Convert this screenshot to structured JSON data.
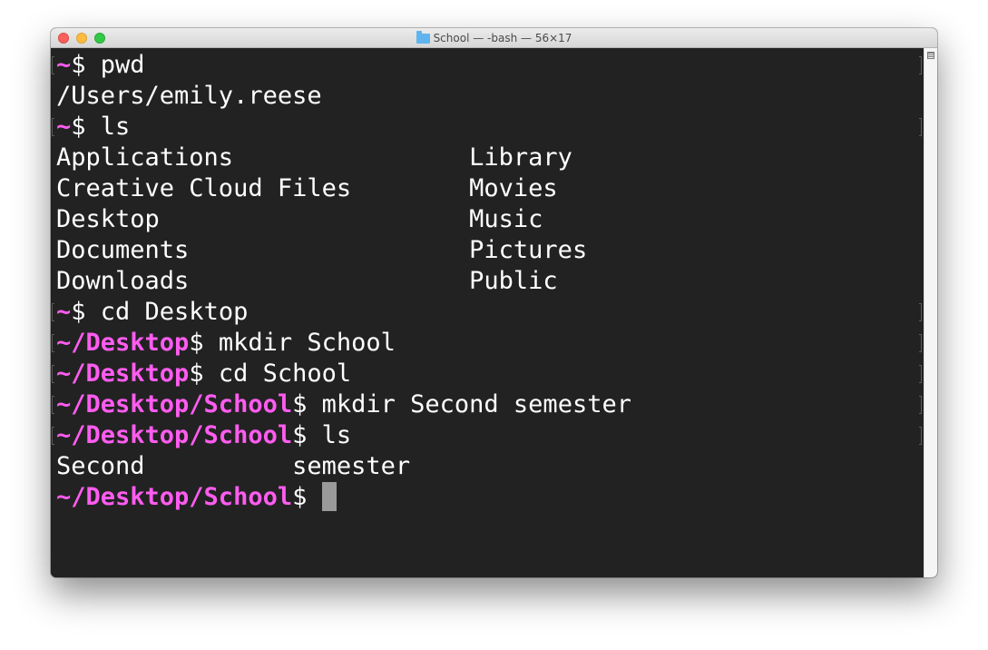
{
  "window": {
    "title": "School — -bash — 56×17",
    "accent_prompt_color": "#ff5cf0",
    "background_color": "#222222"
  },
  "terminal": {
    "lines": [
      {
        "prompt": "~",
        "text": "$ pwd"
      },
      {
        "prompt": "",
        "text": "/Users/emily.reese"
      },
      {
        "prompt": "~",
        "text": "$ ls"
      },
      {
        "prompt": "",
        "text": "Applications                Library"
      },
      {
        "prompt": "",
        "text": "Creative Cloud Files        Movies"
      },
      {
        "prompt": "",
        "text": "Desktop                     Music"
      },
      {
        "prompt": "",
        "text": "Documents                   Pictures"
      },
      {
        "prompt": "",
        "text": "Downloads                   Public"
      },
      {
        "prompt": "~",
        "text": "$ cd Desktop"
      },
      {
        "prompt": "~/Desktop",
        "text": "$ mkdir School"
      },
      {
        "prompt": "~/Desktop",
        "text": "$ cd School"
      },
      {
        "prompt": "~/Desktop/School",
        "text": "$ mkdir Second semester"
      },
      {
        "prompt": "~/Desktop/School",
        "text": "$ ls"
      },
      {
        "prompt": "",
        "text": "Second          semester"
      },
      {
        "prompt": "~/Desktop/School",
        "text": "$ "
      }
    ]
  },
  "icons": {
    "folder": "folder-icon",
    "split_pane": "split-pane-icon"
  }
}
